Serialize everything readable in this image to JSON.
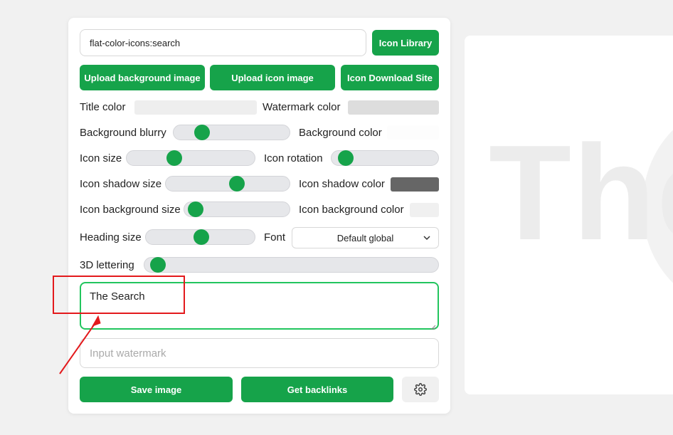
{
  "icon_input": {
    "value": "flat-color-icons:search"
  },
  "buttons": {
    "icon_library": "Icon Library",
    "upload_background": "Upload background image",
    "upload_icon": "Upload icon image",
    "icon_download_site": "Icon Download Site",
    "save_image": "Save image",
    "get_backlinks": "Get backlinks"
  },
  "labels": {
    "title_color": "Title color",
    "watermark_color": "Watermark color",
    "background_blurry": "Background blurry",
    "background_color": "Background color",
    "icon_size": "Icon size",
    "icon_rotation": "Icon rotation",
    "icon_shadow_size": "Icon shadow size",
    "icon_shadow_color": "Icon shadow color",
    "icon_background_size": "Icon background size",
    "icon_background_color": "Icon background color",
    "heading_size": "Heading size",
    "font": "Font",
    "lettering_3d": "3D lettering"
  },
  "colors": {
    "accent": "#16a34a",
    "title_color": "#eeeeee",
    "watermark_color": "#dddddd",
    "background_color": "#fdfdfd",
    "icon_shadow_color": "#666666",
    "icon_background_color": "#f0f0f0",
    "annotation": "#e3191c"
  },
  "sliders": {
    "background_blurry": 0.2,
    "icon_size": 0.35,
    "icon_rotation": 0.07,
    "icon_shadow_size": 0.58,
    "icon_background_size": 0.04,
    "heading_size": 0.5,
    "lettering_3d": 0.02
  },
  "font_select": {
    "value": "Default global"
  },
  "title_textarea": {
    "value": "The Search"
  },
  "watermark_input": {
    "placeholder": "Input watermark"
  },
  "preview": {
    "text": "The"
  },
  "icons": {
    "settings": "gear-icon",
    "select_arrow": "chevron-down-icon"
  }
}
